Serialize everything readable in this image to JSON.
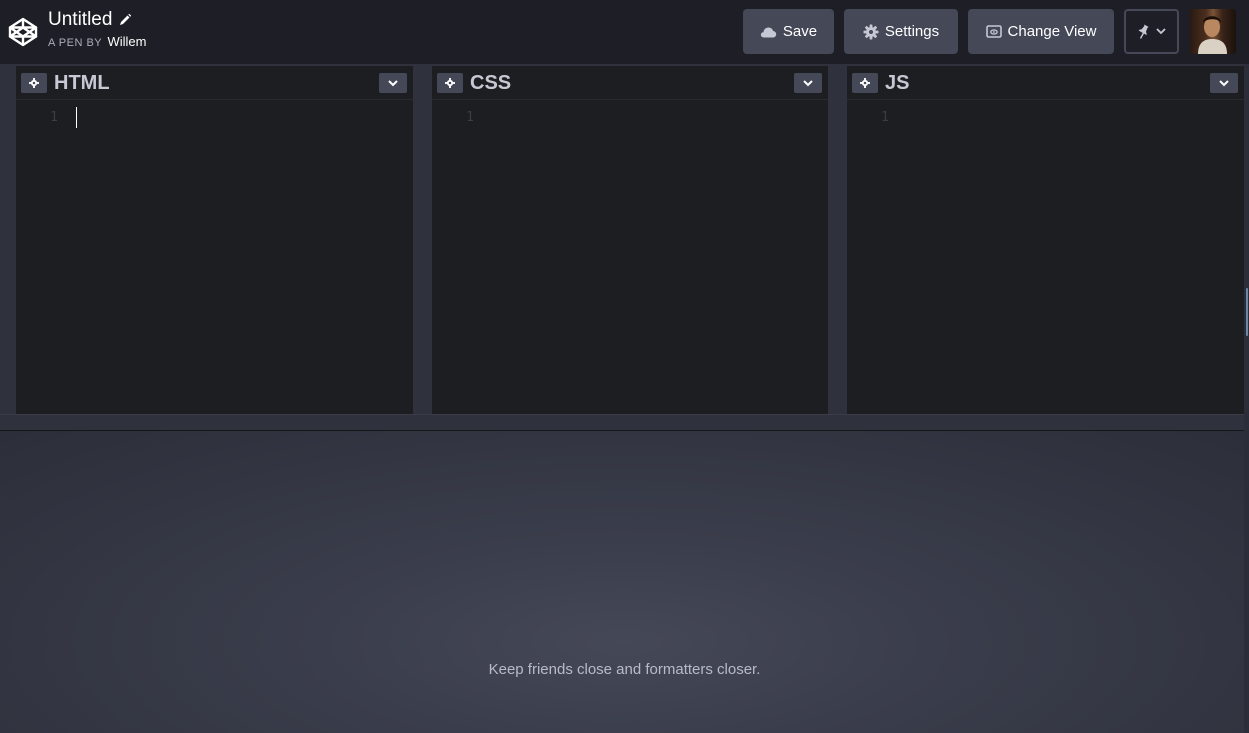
{
  "header": {
    "title": "Untitled",
    "byline_prefix": "A PEN BY",
    "author": "Willem",
    "buttons": {
      "save": "Save",
      "settings": "Settings",
      "change_view": "Change View"
    }
  },
  "editors": [
    {
      "name": "HTML",
      "line_number": "1"
    },
    {
      "name": "CSS",
      "line_number": "1"
    },
    {
      "name": "JS",
      "line_number": "1"
    }
  ],
  "preview": {
    "tip": "Keep friends close and formatters closer."
  },
  "colors": {
    "header_bg": "#1e1f26",
    "button_bg": "#444857",
    "editor_bg": "#1d1e22",
    "preview_bg": "#3a3d4b"
  }
}
